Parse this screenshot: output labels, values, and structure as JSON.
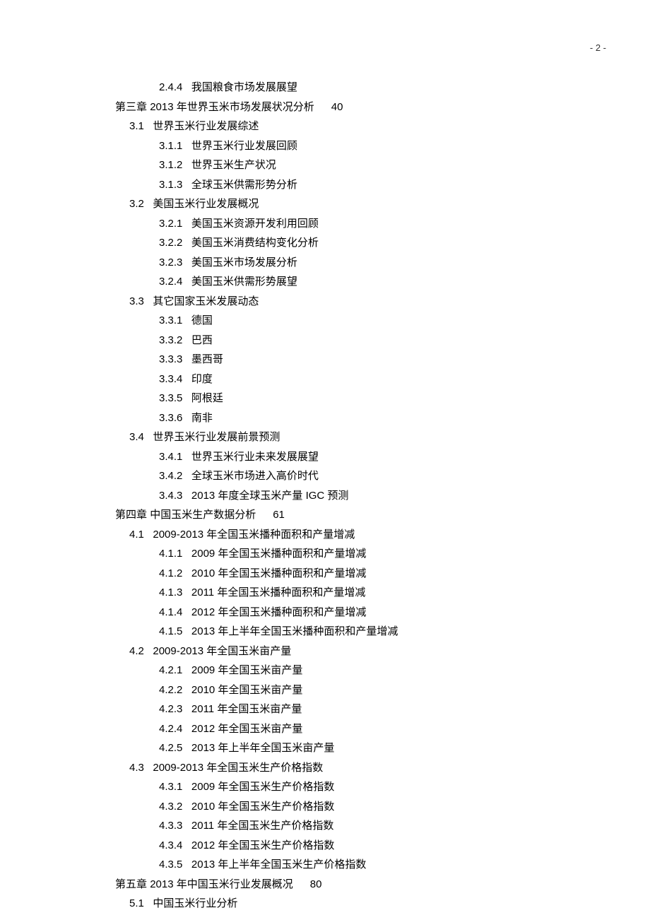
{
  "page_number": "- 2 -",
  "lines": [
    {
      "lvl": "lvl-3",
      "num": "2.4.4",
      "text": "我国粮食市场发展展望",
      "page": ""
    },
    {
      "lvl": "lvl-ch",
      "num": "第三章",
      "text": "2013 年世界玉米市场发展状况分析",
      "page": "40"
    },
    {
      "lvl": "lvl-sec",
      "num": "3.1",
      "text": "世界玉米行业发展综述",
      "page": ""
    },
    {
      "lvl": "lvl-3",
      "num": "3.1.1",
      "text": "世界玉米行业发展回顾",
      "page": ""
    },
    {
      "lvl": "lvl-3",
      "num": "3.1.2",
      "text": "世界玉米生产状况",
      "page": ""
    },
    {
      "lvl": "lvl-3",
      "num": "3.1.3",
      "text": "全球玉米供需形势分析",
      "page": ""
    },
    {
      "lvl": "lvl-sec",
      "num": "3.2",
      "text": "美国玉米行业发展概况",
      "page": ""
    },
    {
      "lvl": "lvl-3",
      "num": "3.2.1",
      "text": "美国玉米资源开发利用回顾",
      "page": ""
    },
    {
      "lvl": "lvl-3",
      "num": "3.2.2",
      "text": "美国玉米消费结构变化分析",
      "page": ""
    },
    {
      "lvl": "lvl-3",
      "num": "3.2.3",
      "text": "美国玉米市场发展分析",
      "page": ""
    },
    {
      "lvl": "lvl-3",
      "num": "3.2.4",
      "text": "美国玉米供需形势展望",
      "page": ""
    },
    {
      "lvl": "lvl-sec",
      "num": "3.3",
      "text": "其它国家玉米发展动态",
      "page": ""
    },
    {
      "lvl": "lvl-3",
      "num": "3.3.1",
      "text": "德国",
      "page": ""
    },
    {
      "lvl": "lvl-3",
      "num": "3.3.2",
      "text": "巴西",
      "page": ""
    },
    {
      "lvl": "lvl-3",
      "num": "3.3.3",
      "text": "墨西哥",
      "page": ""
    },
    {
      "lvl": "lvl-3",
      "num": "3.3.4",
      "text": "印度",
      "page": ""
    },
    {
      "lvl": "lvl-3",
      "num": "3.3.5",
      "text": "阿根廷",
      "page": ""
    },
    {
      "lvl": "lvl-3",
      "num": "3.3.6",
      "text": "南非",
      "page": ""
    },
    {
      "lvl": "lvl-sec",
      "num": "3.4",
      "text": "世界玉米行业发展前景预测",
      "page": ""
    },
    {
      "lvl": "lvl-3",
      "num": "3.4.1",
      "text": "世界玉米行业未来发展展望",
      "page": ""
    },
    {
      "lvl": "lvl-3",
      "num": "3.4.2",
      "text": "全球玉米市场进入高价时代",
      "page": ""
    },
    {
      "lvl": "lvl-3",
      "num": "3.4.3",
      "text": "2013 年度全球玉米产量 IGC 预测",
      "page": ""
    },
    {
      "lvl": "lvl-ch",
      "num": "第四章",
      "text": "中国玉米生产数据分析",
      "page": "61"
    },
    {
      "lvl": "lvl-sec",
      "num": "4.1",
      "text": "2009-2013 年全国玉米播种面积和产量增减",
      "page": ""
    },
    {
      "lvl": "lvl-3",
      "num": "4.1.1",
      "text": "2009 年全国玉米播种面积和产量增减",
      "page": ""
    },
    {
      "lvl": "lvl-3",
      "num": "4.1.2",
      "text": "2010 年全国玉米播种面积和产量增减",
      "page": ""
    },
    {
      "lvl": "lvl-3",
      "num": "4.1.3",
      "text": "2011 年全国玉米播种面积和产量增减",
      "page": ""
    },
    {
      "lvl": "lvl-3",
      "num": "4.1.4",
      "text": "2012 年全国玉米播种面积和产量增减",
      "page": ""
    },
    {
      "lvl": "lvl-3",
      "num": "4.1.5",
      "text": "2013 年上半年全国玉米播种面积和产量增减",
      "page": ""
    },
    {
      "lvl": "lvl-sec",
      "num": "4.2",
      "text": "2009-2013 年全国玉米亩产量",
      "page": ""
    },
    {
      "lvl": "lvl-3",
      "num": "4.2.1",
      "text": "2009 年全国玉米亩产量",
      "page": ""
    },
    {
      "lvl": "lvl-3",
      "num": "4.2.2",
      "text": "2010 年全国玉米亩产量",
      "page": ""
    },
    {
      "lvl": "lvl-3",
      "num": "4.2.3",
      "text": "2011 年全国玉米亩产量",
      "page": ""
    },
    {
      "lvl": "lvl-3",
      "num": "4.2.4",
      "text": "2012 年全国玉米亩产量",
      "page": ""
    },
    {
      "lvl": "lvl-3",
      "num": "4.2.5",
      "text": "2013 年上半年全国玉米亩产量",
      "page": ""
    },
    {
      "lvl": "lvl-sec",
      "num": "4.3",
      "text": "2009-2013 年全国玉米生产价格指数",
      "page": ""
    },
    {
      "lvl": "lvl-3",
      "num": "4.3.1",
      "text": "2009 年全国玉米生产价格指数",
      "page": ""
    },
    {
      "lvl": "lvl-3",
      "num": "4.3.2",
      "text": "2010 年全国玉米生产价格指数",
      "page": ""
    },
    {
      "lvl": "lvl-3",
      "num": "4.3.3",
      "text": "2011 年全国玉米生产价格指数",
      "page": ""
    },
    {
      "lvl": "lvl-3",
      "num": "4.3.4",
      "text": "2012 年全国玉米生产价格指数",
      "page": ""
    },
    {
      "lvl": "lvl-3",
      "num": "4.3.5",
      "text": "2013 年上半年全国玉米生产价格指数",
      "page": ""
    },
    {
      "lvl": "lvl-ch",
      "num": "第五章",
      "text": "2013 年中国玉米行业发展概况",
      "page": "80"
    },
    {
      "lvl": "lvl-sec",
      "num": "5.1",
      "text": "中国玉米行业分析",
      "page": ""
    }
  ]
}
